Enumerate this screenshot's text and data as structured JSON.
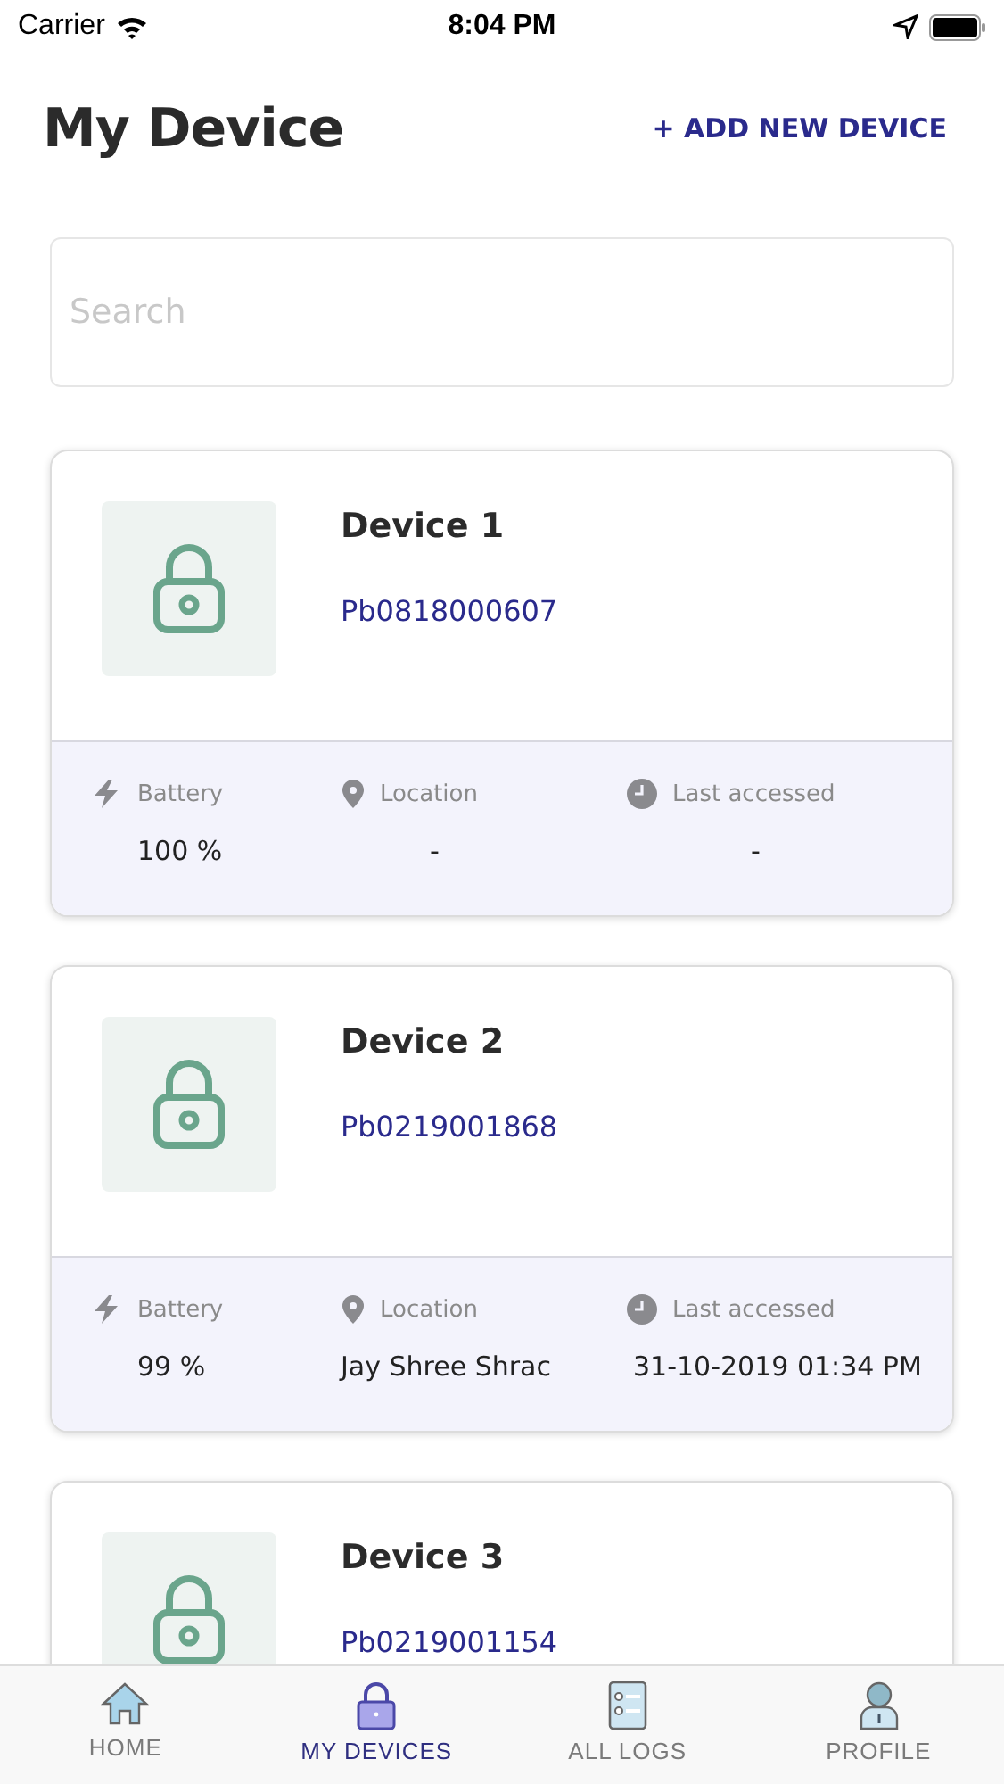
{
  "status_bar": {
    "carrier": "Carrier",
    "time": "8:04 PM"
  },
  "header": {
    "title": "My Device",
    "action": "+ ADD NEW DEVICE"
  },
  "search": {
    "placeholder": "Search"
  },
  "devices": [
    {
      "name": "Device 1",
      "serial": "Pb0818000607",
      "battery_label": "Battery",
      "battery": "100 %",
      "location_label": "Location",
      "location": "-",
      "accessed_label": "Last accessed",
      "accessed": "-"
    },
    {
      "name": "Device 2",
      "serial": "Pb0219001868",
      "battery_label": "Battery",
      "battery": "99 %",
      "location_label": "Location",
      "location": "Jay Shree Shrac",
      "accessed_label": "Last accessed",
      "accessed": "31-10-2019 01:34 PM"
    },
    {
      "name": "Device 3",
      "serial": "Pb0219001154"
    }
  ],
  "tabs": [
    {
      "kind": "home",
      "label": "HOME",
      "selected": false
    },
    {
      "kind": "lock",
      "label": "MY DEVICES",
      "selected": true
    },
    {
      "kind": "logs",
      "label": "ALL LOGS",
      "selected": false
    },
    {
      "kind": "profile",
      "label": "PROFILE",
      "selected": false
    }
  ]
}
